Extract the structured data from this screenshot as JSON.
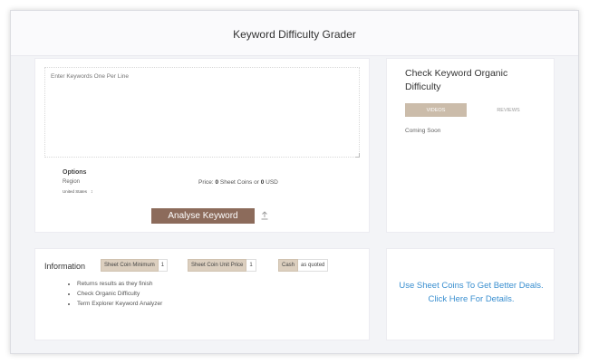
{
  "header": {
    "title": "Keyword Difficulty Grader"
  },
  "main": {
    "keywords_placeholder": "Enter Keywords One Per Line",
    "options_label": "Options",
    "region_label": "Region",
    "region_value": "United States",
    "price_prefix": "Price:",
    "price_coins": "0",
    "price_middle": "Sheet Coins or",
    "price_usd": "0",
    "price_suffix": "USD",
    "analyse_label": "Analyse Keyword"
  },
  "side": {
    "title": "Check Keyword Organic Difficulty",
    "tab_videos": "VIDEOS",
    "tab_reviews": "REVIEWS",
    "coming_soon": "Coming Soon"
  },
  "info": {
    "title": "Information",
    "tags": [
      {
        "key": "Sheet Coin Minimum",
        "value": "1"
      },
      {
        "key": "Sheet Coin Unit Price",
        "value": "1"
      },
      {
        "key": "Cash",
        "value": "as quoted"
      }
    ],
    "items": [
      "Returns results as they finish",
      "Check Organic Difficulty",
      "Term Explorer Keyword Analyzer"
    ]
  },
  "promo": {
    "text": "Use Sheet Coins To Get Better Deals. Click Here For Details."
  },
  "colors": {
    "accent": "#8c6b5b",
    "tab_active": "#cbbcaa",
    "tag_bg": "#dccfbf",
    "link": "#3a8fd0"
  }
}
